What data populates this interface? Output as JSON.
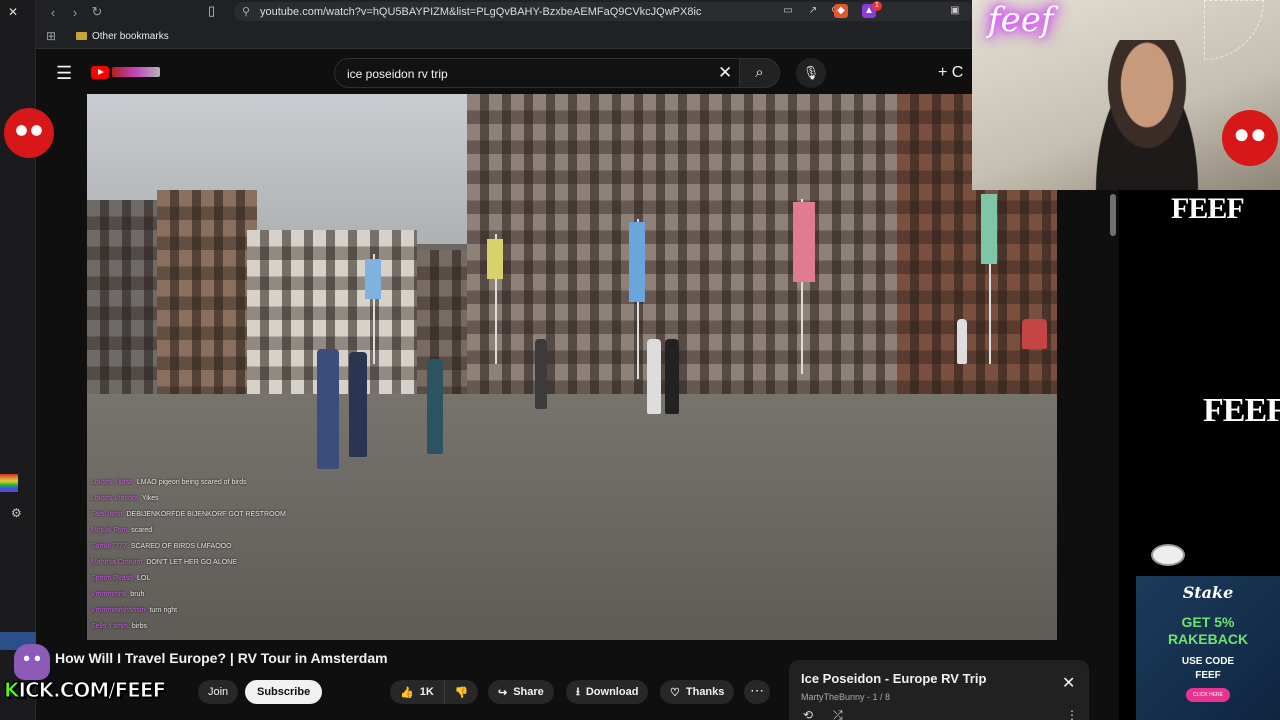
{
  "browser": {
    "url": "youtube.com/watch?v=hQU5BAYPIZM&list=PLgQvBAHY-BzxbeAEMFaQ9CVkcJQwPX8ic",
    "bookmark_folder": "Other bookmarks",
    "extension_badge": "1"
  },
  "youtube": {
    "search_query": "ice poseidon rv trip",
    "create_label": "C"
  },
  "video": {
    "title": "How Will I Travel Europe? | RV Tour in Amsterdam",
    "chat": [
      {
        "user": "Lousm Yllasa",
        "text": "LMAO pigeon being scared of birds"
      },
      {
        "user": "Lousm Vraxom",
        "text": "Yikes"
      },
      {
        "user": "Falsl Ismit",
        "text": "DEBIJENKORFDE BIJENKORF GOT RESTROOM"
      },
      {
        "user": "Migual Fsm",
        "text": "scared"
      },
      {
        "user": "Samuf7777",
        "text": "SCARED OF BIRDS LMFAOOO"
      },
      {
        "user": "Mahhsa Cmnam",
        "text": "DON'T LET HER GO ALONE"
      },
      {
        "user": "Spmm Rvasd",
        "text": "LOL"
      },
      {
        "user": "Vmmmmns",
        "text": "bruh"
      },
      {
        "user": "Vmmmmmhshsm",
        "text": "turn right"
      },
      {
        "user": "Sells Ysmm",
        "text": "birbs"
      }
    ]
  },
  "actions": {
    "join": "Join",
    "subscribe": "Subscribe",
    "likes": "1K",
    "share": "Share",
    "download": "Download",
    "thanks": "Thanks"
  },
  "playlist": {
    "title": "Ice Poseidon - Europe RV Trip",
    "subtitle": "MartyTheBunny - 1 / 8"
  },
  "overlay": {
    "neon_sign": "feef",
    "feef_top": "FEEF",
    "feef_mid": "FEEF",
    "kick_prefix": "K",
    "kick_text": "ICK.COM/FEEF"
  },
  "stake_ad": {
    "logo": "Stake",
    "promo_line1": "GET 5%",
    "promo_line2": "RAKEBACK",
    "code_label": "USE CODE",
    "code": "FEEF",
    "button": "CLICK HERE"
  },
  "colors": {
    "youtube_red": "#ff0000",
    "kick_green": "#53fc18",
    "stake_green": "#6fe36f",
    "neon_purple": "#e04dff"
  }
}
